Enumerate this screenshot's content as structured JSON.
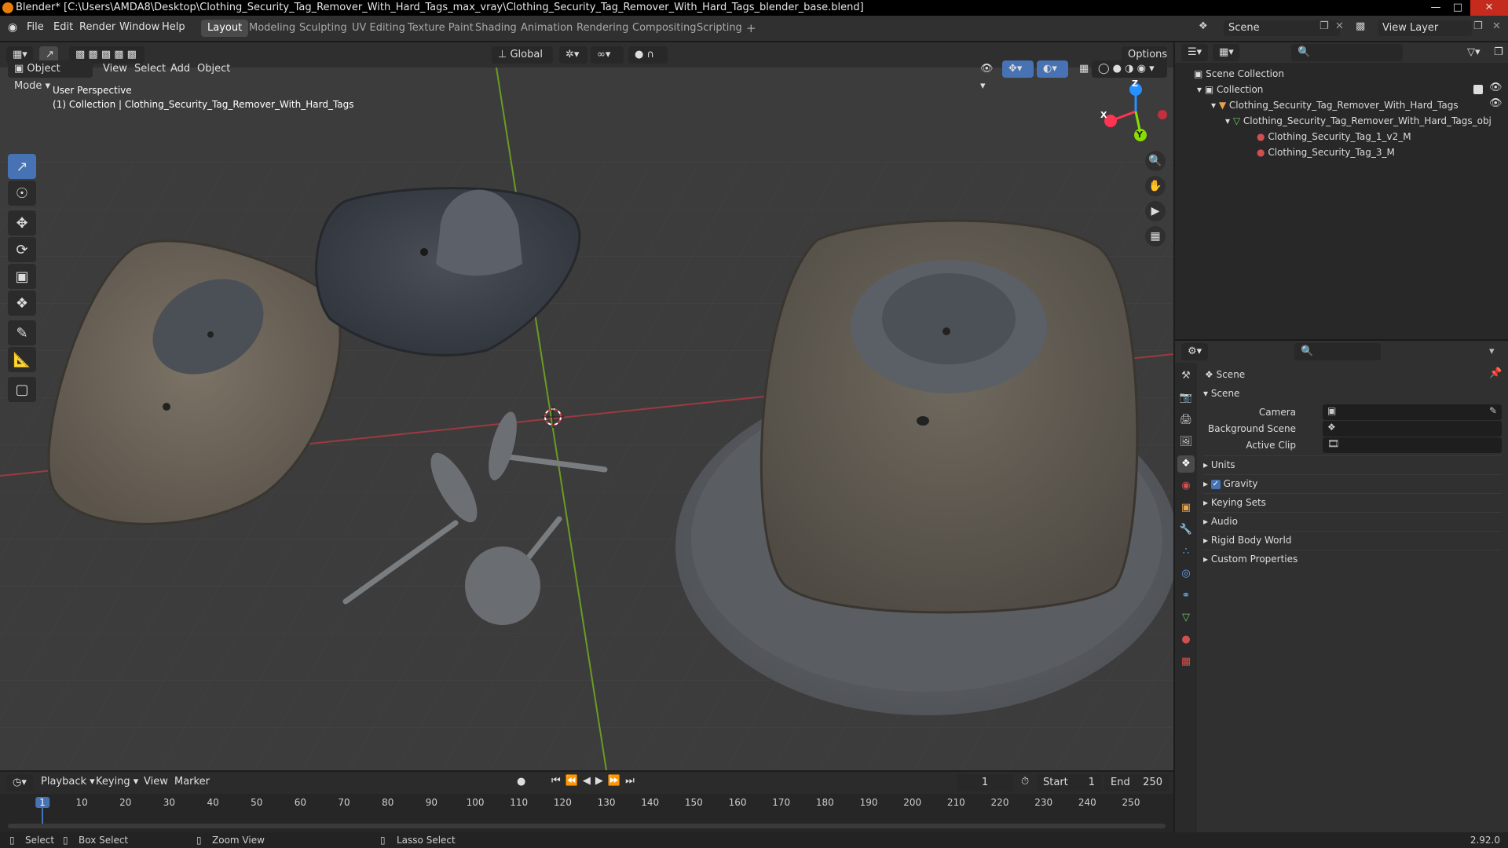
{
  "titlebar": {
    "text": "Blender* [C:\\Users\\AMDA8\\Desktop\\Clothing_Security_Tag_Remover_With_Hard_Tags_max_vray\\Clothing_Security_Tag_Remover_With_Hard_Tags_blender_base.blend]"
  },
  "menus": [
    "File",
    "Edit",
    "Render",
    "Window",
    "Help"
  ],
  "workspaces": [
    "Layout",
    "Modeling",
    "Sculpting",
    "UV Editing",
    "Texture Paint",
    "Shading",
    "Animation",
    "Rendering",
    "Compositing",
    "Scripting"
  ],
  "workspace_add": "+",
  "topbar": {
    "scene_label": "Scene",
    "view_layer_label": "View Layer",
    "options_label": "Options",
    "orientation": "Global"
  },
  "viewport_header": {
    "mode": "Object Mode",
    "menus": [
      "View",
      "Select",
      "Add",
      "Object"
    ]
  },
  "viewport": {
    "perspective": "User Perspective",
    "collection_info": "(1) Collection | Clothing_Security_Tag_Remover_With_Hard_Tags"
  },
  "gizmo": {
    "x": "X",
    "y": "Y",
    "z": "Z"
  },
  "outliner": {
    "root": "Scene Collection",
    "items": [
      {
        "label": "Collection"
      },
      {
        "label": "Clothing_Security_Tag_Remover_With_Hard_Tags"
      },
      {
        "label": "Clothing_Security_Tag_Remover_With_Hard_Tags_obj"
      },
      {
        "label": "Clothing_Security_Tag_1_v2_M"
      },
      {
        "label": "Clothing_Security_Tag_3_M"
      }
    ]
  },
  "properties": {
    "context": "Scene",
    "panel": "Scene",
    "fields": [
      {
        "label": "Camera"
      },
      {
        "label": "Background Scene"
      },
      {
        "label": "Active Clip"
      }
    ],
    "subpanels": [
      "Units",
      "Gravity",
      "Keying Sets",
      "Audio",
      "Rigid Body World",
      "Custom Properties"
    ],
    "gravity_checked": true
  },
  "timeline": {
    "menus": [
      "Playback",
      "Keying",
      "View",
      "Marker"
    ],
    "current_frame": "1",
    "start_label": "Start",
    "start_value": "1",
    "end_label": "End",
    "end_value": "250",
    "ticks": [
      "1",
      "10",
      "20",
      "30",
      "40",
      "50",
      "60",
      "70",
      "80",
      "90",
      "100",
      "110",
      "120",
      "130",
      "140",
      "150",
      "160",
      "170",
      "180",
      "190",
      "200",
      "210",
      "220",
      "230",
      "240",
      "250"
    ]
  },
  "statusbar": {
    "select": "Select",
    "box_select": "Box Select",
    "zoom_view": "Zoom View",
    "lasso_select": "Lasso Select",
    "version": "2.92.0"
  },
  "colors": {
    "accent": "#4772b3",
    "x_axis": "#ff3352",
    "y_axis": "#8bdc00",
    "z_axis": "#2890ff",
    "blender_orange": "#e87d0d"
  }
}
